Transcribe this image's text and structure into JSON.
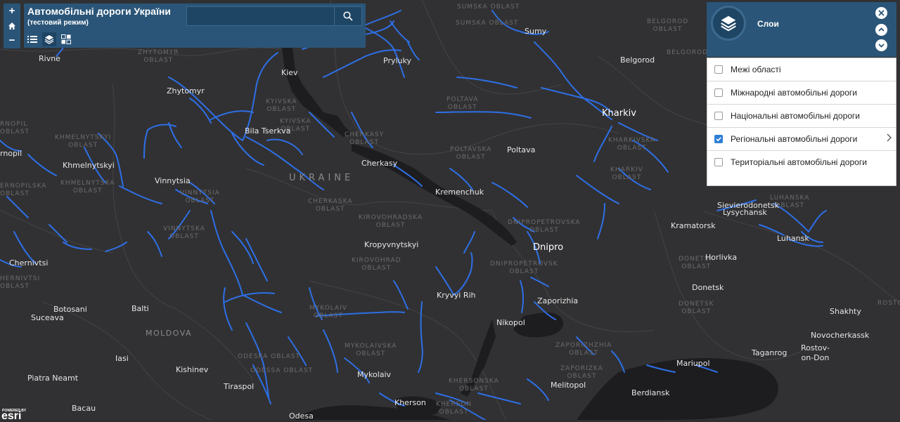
{
  "app": {
    "title": "Автомобільні дороги України",
    "subtitle": "(тестовий режим)"
  },
  "zoom": {
    "in_label": "+",
    "out_label": "−"
  },
  "search": {
    "value": "",
    "placeholder": ""
  },
  "layers_panel": {
    "title": "Слои",
    "items": [
      {
        "label": "Межі області",
        "checked": false
      },
      {
        "label": "Міжнародні автомобільні дороги",
        "checked": false
      },
      {
        "label": "Національні автомобільні дороги",
        "checked": false
      },
      {
        "label": "Регіональні автомобільні дороги",
        "checked": true
      },
      {
        "label": "Територіальні автомобільні дороги",
        "checked": false
      }
    ]
  },
  "map": {
    "country": "UKRAINE",
    "country_moldova": "MOLDOVA",
    "cities": {
      "rivne": "Rivne",
      "zhytomyr": "Zhytomyr",
      "kiev": "Kiev",
      "pryluky": "Pryluky",
      "sumy": "Sumy",
      "belgorod": "Belgorod",
      "bila_tserkva": "Bila Tserkva",
      "kharkiv": "Kharkiv",
      "ternopil": "rnopil",
      "khmelnytskyi": "Khmelnytskyi",
      "vinnytsia": "Vinnytsia",
      "cherkasy": "Cherkasy",
      "poltava": "Poltava",
      "kremenchuk": "Kremenchuk",
      "sievierodonetsk": "Sievierodonetsk",
      "lysychansk": "Lysychansk",
      "kramatorsk": "Kramatorsk",
      "luhansk": "Luhansk",
      "kropyvnytskyi": "Kropyvnytskyi",
      "dnipro": "Dnipro",
      "chernivtsi": "Chernivtsi",
      "horlivka": "Horlivka",
      "donetsk": "Donetsk",
      "kryvyi_rih": "Kryvyi Rih",
      "zaporizhia": "Zaporizhia",
      "botosani": "Botosani",
      "balti": "Balti",
      "suceava": "Suceava",
      "shakhty": "Shakhty",
      "nikopol": "Nikopol",
      "novocherkassk": "Novocherkassk",
      "taganrog": "Taganrog",
      "rostov": "Rostov-\non-Don",
      "iasi": "Iasi",
      "mariupol": "Mariupol",
      "kishinev": "Kishinev",
      "mykolaiv": "Mykolaiv",
      "melitopol": "Melitopol",
      "piatra_neamt": "Piatra Neamt",
      "tiraspol": "Tiraspol",
      "berdiansk": "Berdiansk",
      "kherson": "Kherson",
      "bacau": "Bacau",
      "odesa": "Odesa"
    },
    "regions": {
      "zhytomyr": "ZHYTOMYR\nOBLAST",
      "sumska": "SUMSKA OBLAST",
      "sumska2": "SUMSKA OBLAST",
      "sumska_top": "SUMSKA OBLAST",
      "belgorod": "BELGOROD\nOBLAST",
      "belgorod2": "BELGOROD OBLAST",
      "kyivska": "KYIVSKA\nOBLAST",
      "kyivska2": "KYIVSKA\nOBLAST",
      "poltava": "POLTAVA\nOBLAST",
      "poltavska": "POLTAVSKA\nOBLAST",
      "kharkivska": "KHARKIVSKA\nOBLAST",
      "kharkiv": "KHARKIV\nOBLAST",
      "luhanska": "LUHANSKA\nOBLAST",
      "cherkasy": "CHERKASY\nOBLAST",
      "cherkaska": "CHERKASKA\nOBLAST",
      "khmelnytskyi": "KHMELNYTSKYI\nOBLAST",
      "khmelnytska": "KHMELNYTSKA\nOBLAST",
      "vinnytsia": "VINNYTSIA\nOBLAST",
      "vinnytska": "VINNYTSKA\nOBLAST",
      "kirovohradska": "KIROVOHRADSKA\nOBLAST",
      "kirovohrad": "KIROVOHRAD\nOBLAST",
      "dnipropetrovska": "DNIPROPETROVSKA\nOBLAST",
      "dnipropetrovsk": "DNIPROPETROVSK\nOBLAST",
      "donetsk": "DONETSK\nOBLAST",
      "donetsk2": "DONETSK\nOBLAST",
      "mykolaiv": "MYKOLAIV\nOBLAST",
      "mykolaivska": "MYKOLAIVSKA\nOBLAST",
      "zaporizhzhia": "ZAPORIZHZHIA\nOBLAST",
      "zaporizka": "ZAPORIZKA\nOBLAST",
      "odeska": "ODESKA OBLAST",
      "odessa": "ODESSA OBLAST",
      "khersonska": "KHERSONSKA\nOBLAST",
      "kherson": "KHERSON\nOBLAST",
      "left1": "RNOPIL\nOBLAST",
      "left2": "ERNOPILSKA\nOBLAST",
      "left3": "HERNIVTSI\nOBLAST",
      "left4": "ROSTOV"
    },
    "attribution": "POWERED BY",
    "esri_logo": "esri"
  },
  "colors": {
    "road": "#2e6fe6",
    "panel": "#2a5578",
    "water": "#1d1d1f"
  }
}
